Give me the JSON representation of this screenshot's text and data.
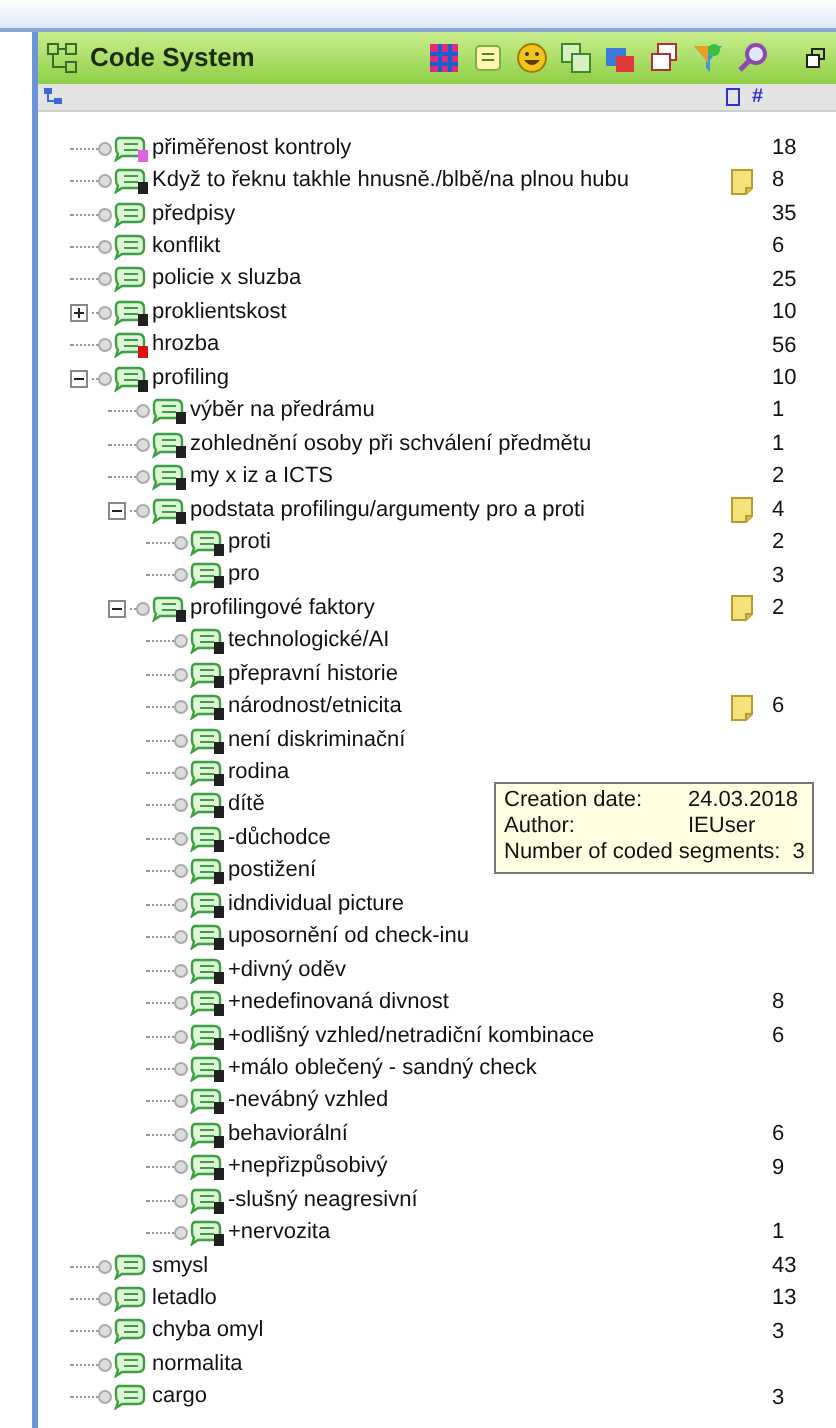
{
  "panel": {
    "title": "Code System",
    "count_header": "#"
  },
  "codes": [
    {
      "name": "přiměřenost kontroly",
      "color": "#e060e0",
      "memo": false,
      "count": "18"
    },
    {
      "name": "Když to řeknu takhle hnusně./blbě/na plnou hubu",
      "color": "#202020",
      "memo": true,
      "count": "8"
    },
    {
      "name": "předpisy",
      "memo": false,
      "count": "35"
    },
    {
      "name": "konflikt",
      "memo": false,
      "count": "6"
    },
    {
      "name": "policie x sluzba",
      "memo": false,
      "count": "25"
    },
    {
      "name": "proklientskost",
      "color": "#202020",
      "memo": false,
      "count": "10",
      "expanded": false
    },
    {
      "name": "hrozba",
      "color": "#e01010",
      "memo": false,
      "count": "56"
    },
    {
      "name": "profiling",
      "color": "#202020",
      "memo": false,
      "count": "10",
      "expanded": true,
      "children": [
        {
          "name": "výběr na předrámu",
          "color": "#202020",
          "memo": false,
          "count": "1"
        },
        {
          "name": "zohlednění osoby při schválení předmětu",
          "color": "#202020",
          "memo": false,
          "count": "1"
        },
        {
          "name": "my x iz a ICTS",
          "color": "#202020",
          "memo": false,
          "count": "2"
        },
        {
          "name": "podstata profilingu/argumenty pro a proti",
          "color": "#202020",
          "memo": true,
          "count": "4",
          "expanded": true,
          "children": [
            {
              "name": "proti",
              "color": "#202020",
              "memo": false,
              "count": "2"
            },
            {
              "name": "pro",
              "color": "#202020",
              "memo": false,
              "count": "3"
            }
          ]
        },
        {
          "name": "profilingové faktory",
          "color": "#202020",
          "memo": true,
          "count": "2",
          "expanded": true,
          "children": [
            {
              "name": "technologické/AI",
              "color": "#202020",
              "memo": false
            },
            {
              "name": "přepravní historie",
              "color": "#202020",
              "memo": false
            },
            {
              "name": "národnost/etnicita",
              "color": "#202020",
              "memo": true,
              "count": "6"
            },
            {
              "name": "není diskriminační",
              "color": "#202020",
              "memo": false
            },
            {
              "name": "rodina",
              "color": "#202020",
              "memo": false
            },
            {
              "name": "dítě",
              "color": "#202020",
              "memo": false
            },
            {
              "name": "-důchodce",
              "color": "#202020",
              "memo": false
            },
            {
              "name": "postižení",
              "color": "#202020",
              "memo": false
            },
            {
              "name": "idndividual picture",
              "color": "#202020",
              "memo": false
            },
            {
              "name": "uposornění od check-inu",
              "color": "#202020",
              "memo": false
            },
            {
              "name": "+divný oděv",
              "color": "#202020",
              "memo": false
            },
            {
              "name": "+nedefinovaná divnost",
              "color": "#202020",
              "memo": false,
              "count": "8"
            },
            {
              "name": "+odlišný vzhled/netradiční kombinace",
              "color": "#202020",
              "memo": false,
              "count": "6"
            },
            {
              "name": "+málo oblečený - sandný check",
              "color": "#202020",
              "memo": false
            },
            {
              "name": "-nevábný vzhled",
              "color": "#202020",
              "memo": false
            },
            {
              "name": "behaviorální",
              "color": "#202020",
              "memo": false,
              "count": "6"
            },
            {
              "name": "+nepřizpůsobivý",
              "color": "#202020",
              "memo": false,
              "count": "9"
            },
            {
              "name": "-slušný neagresivní",
              "color": "#202020",
              "memo": false
            },
            {
              "name": "+nervozita",
              "color": "#202020",
              "memo": false,
              "count": "1"
            }
          ]
        }
      ]
    },
    {
      "name": "smysl",
      "memo": false,
      "count": "43"
    },
    {
      "name": "letadlo",
      "memo": false,
      "count": "13"
    },
    {
      "name": "chyba omyl",
      "memo": false,
      "count": "3"
    },
    {
      "name": "normalita",
      "memo": false
    },
    {
      "name": "cargo",
      "memo": false,
      "count": "3"
    }
  ],
  "tooltip": {
    "rows": [
      {
        "label": "Creation date:",
        "value": "24.03.2018"
      },
      {
        "label": "Author:",
        "value": "IEUser"
      },
      {
        "label": "Number of coded segments:",
        "value": "3"
      }
    ]
  }
}
